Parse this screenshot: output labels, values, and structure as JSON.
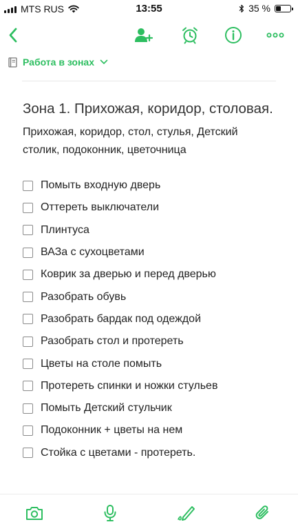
{
  "status_bar": {
    "carrier": "MTS RUS",
    "time": "13:55",
    "battery_percent": "35 %",
    "battery_level": 0.35
  },
  "nav": {
    "back_icon": "chevron-left-icon",
    "actions": [
      "add-person-icon",
      "alarm-clock-icon",
      "info-icon",
      "more-icon"
    ]
  },
  "notebook": {
    "icon": "notebook-icon",
    "name": "Работа в зонах",
    "chevron_icon": "chevron-down-icon"
  },
  "note": {
    "title": "Зона 1. Прихожая, коридор, столовая.",
    "description": "Прихожая, коридор, стол, стулья, Детский столик, подоконник, цветочница",
    "checklist": [
      "Помыть входную дверь",
      "Оттереть выключатели",
      "Плинтуса",
      "ВАЗа с сухоцветами",
      "Коврик за дверью и перед дверью",
      "Разобрать обувь",
      "Разобрать бардак под одеждой",
      "Разобрать стол и протереть",
      "Цветы на столе помыть",
      "Протереть спинки и ножки стульев",
      "Помыть Детский стульчик",
      "Подоконник + цветы на нем",
      "Стойка с цветами - протереть."
    ]
  },
  "toolbar": {
    "tools": [
      "camera-icon",
      "microphone-icon",
      "pen-handwriting-icon",
      "paperclip-icon"
    ]
  },
  "colors": {
    "accent": "#2dbe60",
    "text": "#222222",
    "checkbox_border": "#8a8a8a"
  }
}
